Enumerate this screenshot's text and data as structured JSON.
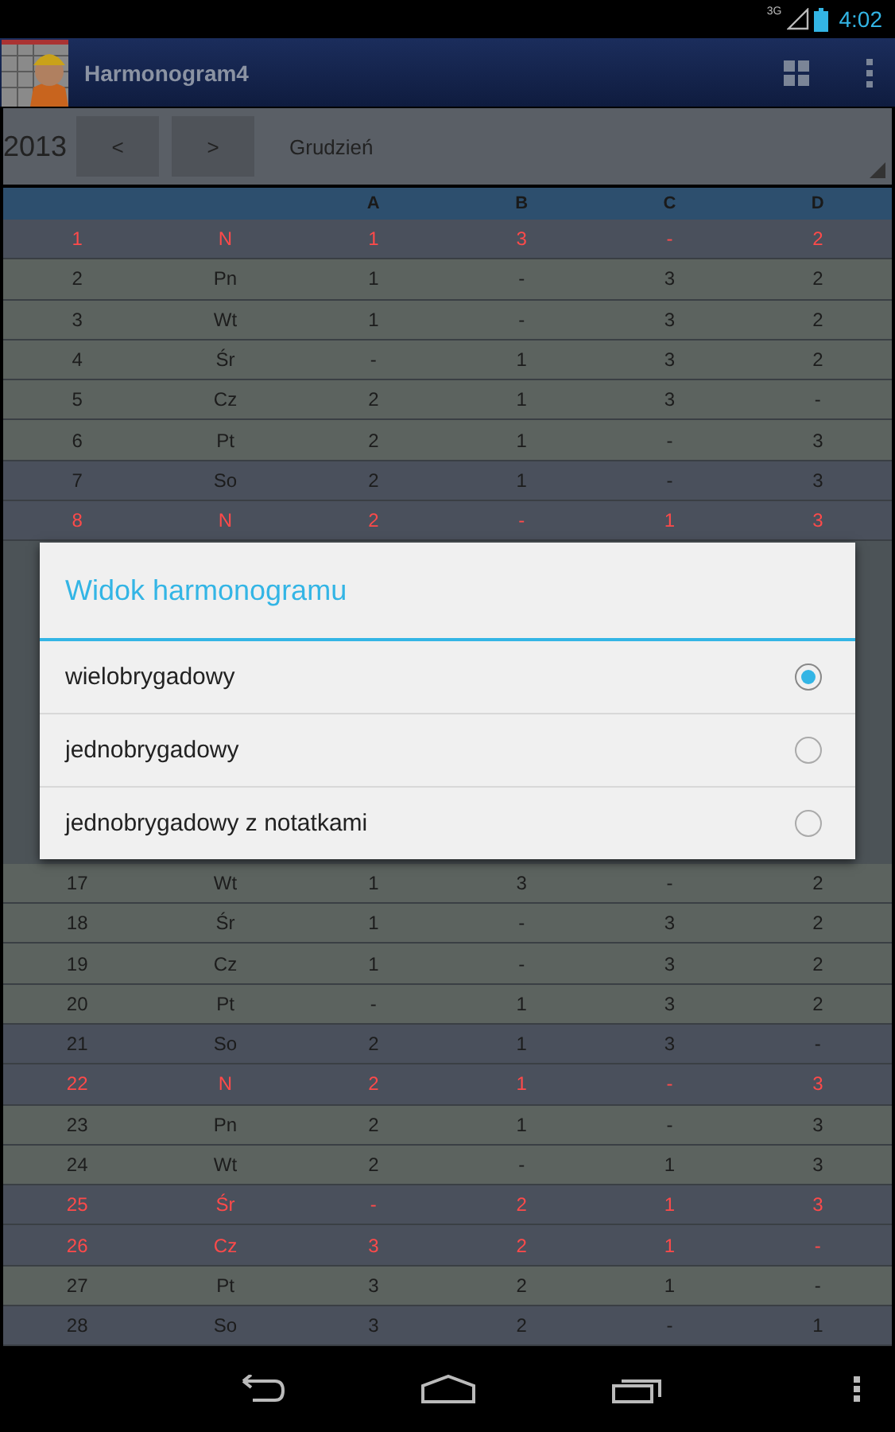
{
  "status_bar": {
    "network": "3G",
    "time": "4:02"
  },
  "app_bar": {
    "title": "Harmonogram4"
  },
  "controls": {
    "year": "2013",
    "prev": "<",
    "next": ">",
    "month": "Grudzień"
  },
  "table": {
    "columns": [
      "A",
      "B",
      "C",
      "D"
    ],
    "rows_top": [
      {
        "day": "1",
        "weekday": "N",
        "kind": "holiday",
        "shifts": [
          "1",
          "3",
          "-",
          "2"
        ]
      },
      {
        "day": "2",
        "weekday": "Pn",
        "kind": "workday",
        "shifts": [
          "1",
          "-",
          "3",
          "2"
        ]
      },
      {
        "day": "3",
        "weekday": "Wt",
        "kind": "workday",
        "shifts": [
          "1",
          "-",
          "3",
          "2"
        ]
      },
      {
        "day": "4",
        "weekday": "Śr",
        "kind": "workday",
        "shifts": [
          "-",
          "1",
          "3",
          "2"
        ]
      },
      {
        "day": "5",
        "weekday": "Cz",
        "kind": "workday",
        "shifts": [
          "2",
          "1",
          "3",
          "-"
        ]
      },
      {
        "day": "6",
        "weekday": "Pt",
        "kind": "workday",
        "shifts": [
          "2",
          "1",
          "-",
          "3"
        ]
      },
      {
        "day": "7",
        "weekday": "So",
        "kind": "weekend",
        "shifts": [
          "2",
          "1",
          "-",
          "3"
        ]
      },
      {
        "day": "8",
        "weekday": "N",
        "kind": "holiday",
        "shifts": [
          "2",
          "-",
          "1",
          "3"
        ]
      }
    ],
    "rows_bottom": [
      {
        "day": "17",
        "weekday": "Wt",
        "kind": "workday",
        "shifts": [
          "1",
          "3",
          "-",
          "2"
        ]
      },
      {
        "day": "18",
        "weekday": "Śr",
        "kind": "workday",
        "shifts": [
          "1",
          "-",
          "3",
          "2"
        ]
      },
      {
        "day": "19",
        "weekday": "Cz",
        "kind": "workday",
        "shifts": [
          "1",
          "-",
          "3",
          "2"
        ]
      },
      {
        "day": "20",
        "weekday": "Pt",
        "kind": "workday",
        "shifts": [
          "-",
          "1",
          "3",
          "2"
        ]
      },
      {
        "day": "21",
        "weekday": "So",
        "kind": "weekend",
        "shifts": [
          "2",
          "1",
          "3",
          "-"
        ]
      },
      {
        "day": "22",
        "weekday": "N",
        "kind": "holiday",
        "shifts": [
          "2",
          "1",
          "-",
          "3"
        ]
      },
      {
        "day": "23",
        "weekday": "Pn",
        "kind": "workday",
        "shifts": [
          "2",
          "1",
          "-",
          "3"
        ]
      },
      {
        "day": "24",
        "weekday": "Wt",
        "kind": "workday",
        "shifts": [
          "2",
          "-",
          "1",
          "3"
        ]
      },
      {
        "day": "25",
        "weekday": "Śr",
        "kind": "holiday",
        "shifts": [
          "-",
          "2",
          "1",
          "3"
        ]
      },
      {
        "day": "26",
        "weekday": "Cz",
        "kind": "holiday",
        "shifts": [
          "3",
          "2",
          "1",
          "-"
        ]
      },
      {
        "day": "27",
        "weekday": "Pt",
        "kind": "workday",
        "shifts": [
          "3",
          "2",
          "1",
          "-"
        ]
      },
      {
        "day": "28",
        "weekday": "So",
        "kind": "weekend",
        "shifts": [
          "3",
          "2",
          "-",
          "1"
        ]
      }
    ]
  },
  "dialog": {
    "title": "Widok harmonogramu",
    "options": [
      {
        "label": "wielobrygadowy",
        "selected": true
      },
      {
        "label": "jednobrygadowy",
        "selected": false
      },
      {
        "label": "jednobrygadowy z notatkami",
        "selected": false
      }
    ]
  }
}
